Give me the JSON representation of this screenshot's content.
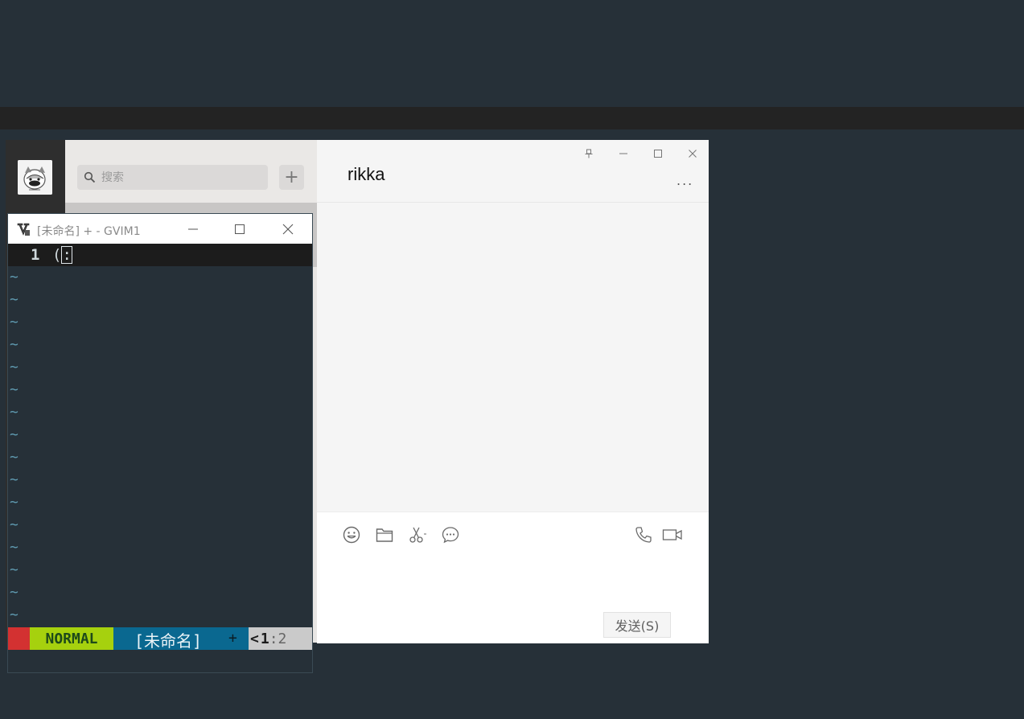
{
  "wechat": {
    "search": {
      "placeholder": "搜索"
    },
    "add_label": "+",
    "chat": {
      "title": "rikka",
      "more_label": "..."
    },
    "send_label": "发送(S)",
    "icons": {
      "pin": "pin-icon",
      "minimize": "minimize-icon",
      "maximize": "maximize-icon",
      "close": "close-icon",
      "emoji": "emoji-icon",
      "folder": "folder-icon",
      "screenshot": "scissors-icon",
      "chat_history": "chat-bubble-icon",
      "voice_call": "phone-icon",
      "video_call": "video-camera-icon"
    }
  },
  "gvim": {
    "title": "[未命名] + - GVIM1",
    "buffer": {
      "line_number": "1",
      "line_text": "(",
      "cursor_char": ":",
      "empty_marker": "~",
      "empty_line_count": 16
    },
    "statusline": {
      "mode": "NORMAL",
      "filename": "[未命名]",
      "modified": "+",
      "pos_prefix": "<",
      "line": "1",
      "sep": ":",
      "col": "2"
    },
    "colors": {
      "mode_bg": "#a6d10e",
      "file_bg": "#0a6890",
      "error_bg": "#d33131"
    }
  }
}
